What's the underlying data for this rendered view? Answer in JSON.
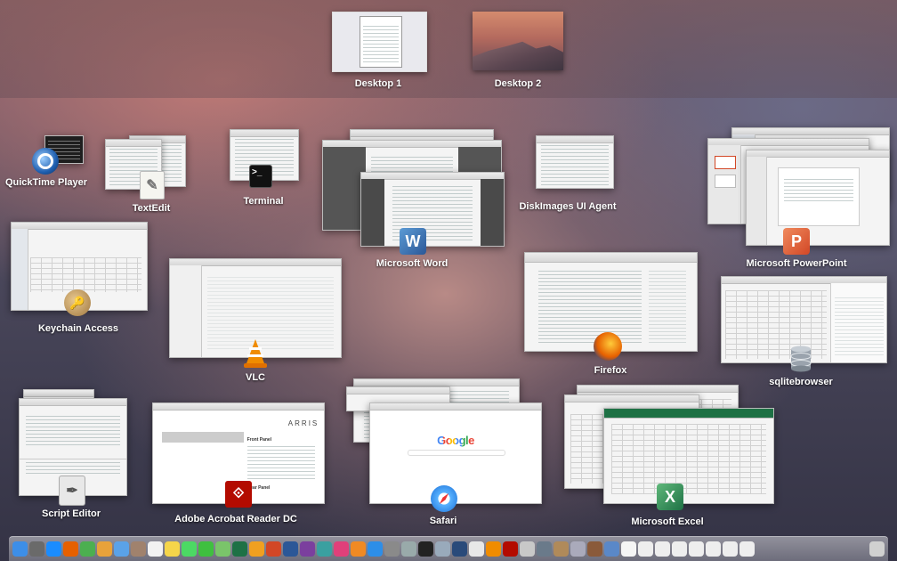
{
  "spaces": {
    "desktops": [
      {
        "label": "Desktop 1"
      },
      {
        "label": "Desktop 2"
      }
    ]
  },
  "apps": {
    "quicktime": {
      "label": "QuickTime Player"
    },
    "textedit": {
      "label": "TextEdit"
    },
    "terminal": {
      "label": "Terminal"
    },
    "word": {
      "label": "Microsoft Word"
    },
    "diskimages": {
      "label": "DiskImages UI Agent"
    },
    "powerpoint": {
      "label": "Microsoft PowerPoint"
    },
    "keychain": {
      "label": "Keychain Access"
    },
    "vlc": {
      "label": "VLC"
    },
    "firefox": {
      "label": "Firefox"
    },
    "sqlitebrowser": {
      "label": "sqlitebrowser"
    },
    "scripteditor": {
      "label": "Script Editor"
    },
    "acrobat": {
      "label": "Adobe Acrobat Reader DC"
    },
    "safari": {
      "label": "Safari"
    },
    "excel": {
      "label": "Microsoft Excel"
    }
  },
  "window_text": {
    "safari_google_logo": "Google",
    "acrobat_brand": "ARRIS",
    "acrobat_section_front": "Front Panel",
    "acrobat_section_rear": "Rear Panel"
  },
  "icons": {
    "quicktime": "quicktime-icon",
    "textedit": "textedit-icon",
    "terminal": "terminal-icon",
    "word": "word-icon",
    "powerpoint": "powerpoint-icon",
    "keychain": "keychain-icon",
    "vlc": "vlc-cone-icon",
    "firefox": "firefox-icon",
    "sqlitebrowser": "database-icon",
    "scripteditor": "script-editor-icon",
    "acrobat": "acrobat-icon",
    "safari": "safari-compass-icon",
    "excel": "excel-icon"
  },
  "colors": {
    "word": "#2b5797",
    "powerpoint": "#d24726",
    "excel": "#1e7145",
    "acrobat": "#b30b00",
    "vlc": "#f08c00",
    "firefox": "#e66000",
    "safari": "#1a8cff"
  },
  "dock": {
    "items": [
      {
        "icon": "finder-icon",
        "color": "#3d8ee8"
      },
      {
        "icon": "launchpad-icon",
        "color": "#6a6a6a"
      },
      {
        "icon": "safari-icon",
        "color": "#1a8cff"
      },
      {
        "icon": "firefox-icon",
        "color": "#e66000"
      },
      {
        "icon": "chrome-icon",
        "color": "#4caf50"
      },
      {
        "icon": "photos-icon",
        "color": "#e8a23a"
      },
      {
        "icon": "mail-icon",
        "color": "#5aa2e8"
      },
      {
        "icon": "contacts-icon",
        "color": "#a0826d"
      },
      {
        "icon": "calendar-icon",
        "color": "#f2f2f2"
      },
      {
        "icon": "notes-icon",
        "color": "#f5d54a"
      },
      {
        "icon": "messages-icon",
        "color": "#4cd964"
      },
      {
        "icon": "facetime-icon",
        "color": "#3fc03f"
      },
      {
        "icon": "maps-icon",
        "color": "#7ac46a"
      },
      {
        "icon": "excel-icon",
        "color": "#1e7145"
      },
      {
        "icon": "outlook-icon",
        "color": "#f0a020"
      },
      {
        "icon": "powerpoint-icon",
        "color": "#d24726"
      },
      {
        "icon": "word-icon",
        "color": "#2b5797"
      },
      {
        "icon": "onenote-icon",
        "color": "#7b3f9e"
      },
      {
        "icon": "lync-icon",
        "color": "#3aa0a0"
      },
      {
        "icon": "itunes-icon",
        "color": "#e0407a"
      },
      {
        "icon": "ibooks-icon",
        "color": "#f08a24"
      },
      {
        "icon": "app-store-icon",
        "color": "#2d8ee8"
      },
      {
        "icon": "system-preferences-icon",
        "color": "#8a8a8a"
      },
      {
        "icon": "help-icon",
        "color": "#9aa"
      },
      {
        "icon": "terminal-icon",
        "color": "#222222"
      },
      {
        "icon": "sqlitebrowser-icon",
        "color": "#9ab"
      },
      {
        "icon": "quicktime-icon",
        "color": "#2a4a7a"
      },
      {
        "icon": "textedit-icon",
        "color": "#e8e8e8"
      },
      {
        "icon": "vlc-icon",
        "color": "#f08c00"
      },
      {
        "icon": "acrobat-icon",
        "color": "#b30b00"
      },
      {
        "icon": "script-editor-icon",
        "color": "#c8c8c8"
      },
      {
        "icon": "automator-icon",
        "color": "#6a7a8a"
      },
      {
        "icon": "keychain-icon",
        "color": "#b08a5a"
      },
      {
        "icon": "disk-utility-icon",
        "color": "#aab"
      },
      {
        "icon": "dictionary-icon",
        "color": "#8a5a3a"
      },
      {
        "icon": "downloads-stack-icon",
        "color": "#5a88c8"
      },
      {
        "icon": "document-icon",
        "color": "#f5f5f5"
      },
      {
        "icon": "minimized-window-icon",
        "color": "#eeeeee"
      },
      {
        "icon": "minimized-window-icon",
        "color": "#eeeeee"
      },
      {
        "icon": "minimized-window-icon",
        "color": "#eeeeee"
      },
      {
        "icon": "minimized-window-icon",
        "color": "#eeeeee"
      },
      {
        "icon": "minimized-window-icon",
        "color": "#eeeeee"
      },
      {
        "icon": "minimized-window-icon",
        "color": "#eeeeee"
      },
      {
        "icon": "minimized-window-icon",
        "color": "#eeeeee"
      },
      {
        "icon": "trash-icon",
        "color": "#d0d0d0"
      }
    ]
  }
}
